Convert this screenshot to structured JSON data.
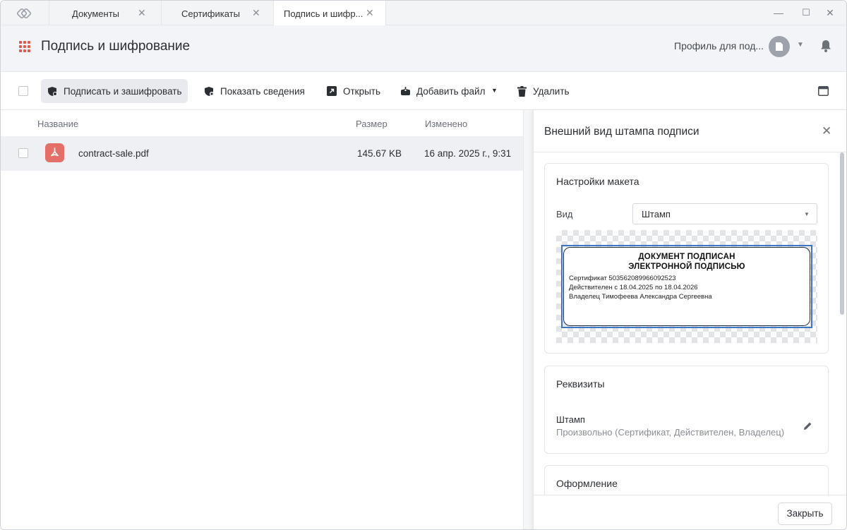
{
  "tabs": [
    {
      "label": "Документы"
    },
    {
      "label": "Сертификаты"
    },
    {
      "label": "Подпись и шифр..."
    }
  ],
  "header": {
    "title": "Подпись и шифрование",
    "profile_label": "Профиль для под..."
  },
  "toolbar": {
    "sign_encrypt": "Подписать и зашифровать",
    "show_details": "Показать сведения",
    "open": "Открыть",
    "add_file": "Добавить файл",
    "delete": "Удалить"
  },
  "table": {
    "columns": [
      "Название",
      "Размер",
      "Изменено"
    ],
    "rows": [
      {
        "name": "contract-sale.pdf",
        "size": "145.67 KB",
        "modified": "16 апр. 2025 г., 9:31"
      }
    ]
  },
  "panel": {
    "title": "Внешний вид штампа подписи",
    "layout_card": {
      "title": "Настройки макета",
      "view_label": "Вид",
      "view_value": "Штамп"
    },
    "stamp": {
      "heading_1": "ДОКУМЕНТ ПОДПИСАН",
      "heading_2": "ЭЛЕКТРОННОЙ ПОДПИСЬЮ",
      "line_certificate": "Сертификат 503562089966092523",
      "line_valid": "Действителен с 18.04.2025 по 18.04.2026",
      "line_owner": "Владелец Тимофеева Александра Сергеевна"
    },
    "requisites_card": {
      "title": "Реквизиты",
      "stamp_label": "Штамп",
      "stamp_value": "Произвольно (Сертификат, Действителен, Владелец)"
    },
    "design_card": {
      "title": "Оформление"
    },
    "close_button": "Закрыть"
  },
  "colors": {
    "accent_red": "#e2584d",
    "pdf_icon": "#e46f68",
    "selection_blue": "#3f77c6"
  }
}
